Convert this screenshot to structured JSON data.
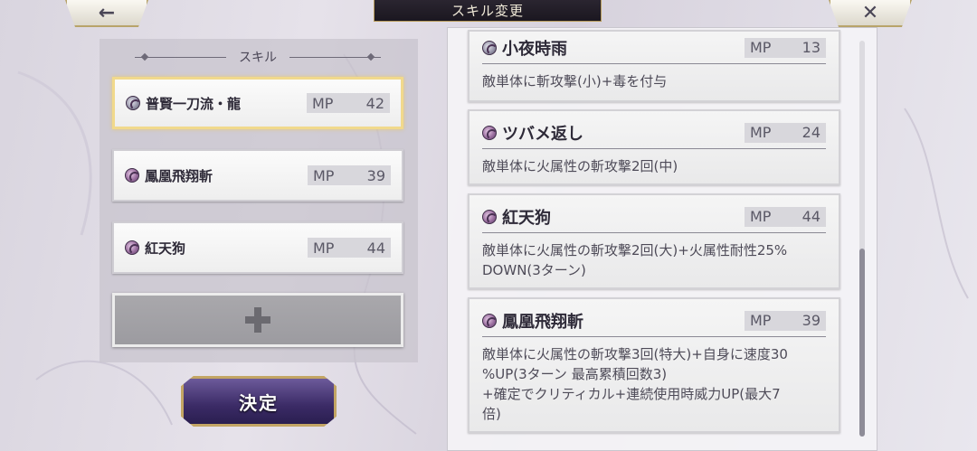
{
  "header": {
    "back_icon": "←",
    "title": "スキル変更",
    "close_icon": "✕"
  },
  "left": {
    "section_title": "スキル",
    "slots": [
      {
        "name": "普賢一刀流・龍",
        "mp_label": "MP",
        "mp": "42",
        "selected": true
      },
      {
        "name": "鳳凰飛翔斬",
        "mp_label": "MP",
        "mp": "39",
        "selected": false
      },
      {
        "name": "紅天狗",
        "mp_label": "MP",
        "mp": "44",
        "selected": false
      }
    ],
    "decide_label": "決定"
  },
  "skill_list": [
    {
      "name": "小夜時雨",
      "mp_label": "MP",
      "mp": "13",
      "desc": "敵単体に斬攻撃(小)+毒を付与"
    },
    {
      "name": "ツバメ返し",
      "mp_label": "MP",
      "mp": "24",
      "desc": "敵単体に火属性の斬攻撃2回(中)"
    },
    {
      "name": "紅天狗",
      "mp_label": "MP",
      "mp": "44",
      "desc": "敵単体に火属性の斬攻撃2回(大)+火属性耐性25%\nDOWN(3ターン)"
    },
    {
      "name": "鳳凰飛翔斬",
      "mp_label": "MP",
      "mp": "39",
      "desc": "敵単体に火属性の斬攻撃3回(特大)+自身に速度30\n%UP(3ターン 最高累積回数3)\n+確定でクリティカル+連続使用時威力UP(最大7\n倍)"
    }
  ],
  "colors": {
    "accent_gold": "#c3a564",
    "decide_purple": "#3b2b66",
    "title_bar": "#1b1720"
  }
}
